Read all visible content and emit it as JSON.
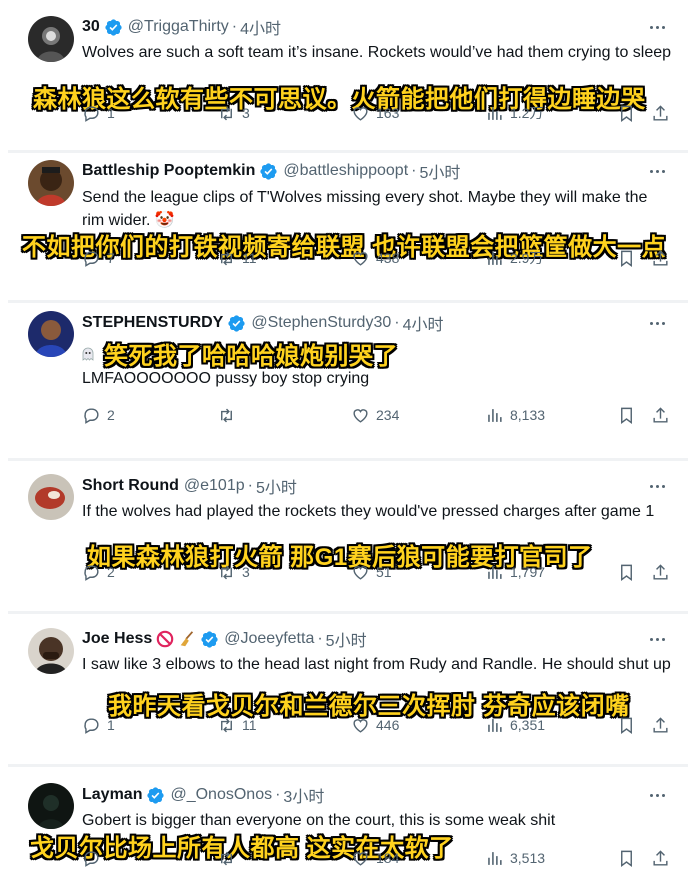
{
  "tweets": [
    {
      "name": "30",
      "handle": "@TriggaThirty",
      "time": "4小时",
      "text": "Wolves are such a soft team it’s insane. Rockets would’ve had them crying to sleep",
      "subtitle": "森林狼这么软有些不可思议。火箭能把他们打得边睡边哭",
      "replies": "1",
      "retweets": "3",
      "likes": "163",
      "views": "1.2万"
    },
    {
      "name": "Battleship Pooptemkin",
      "handle": "@battleshippoopt",
      "time": "5小时",
      "text": "Send the league clips of T'Wolves missing every shot. Maybe they will make the rim wider. 🤡",
      "subtitle": "不如把你们的打铁视频寄给联盟 也许联盟会把篮筐做大一点",
      "replies": "7",
      "retweets": "11",
      "likes": "438",
      "views": "2.9万"
    },
    {
      "name": "STEPHENSTURDY",
      "handle": "@StephenSturdy30",
      "time": "4小时",
      "text": "LMFAOOOOOOO pussy boy stop crying",
      "subtitle": "笑死我了哈哈哈娘炮别哭了",
      "replies": "2",
      "retweets": "",
      "likes": "234",
      "views": "8,133"
    },
    {
      "name": "Short Round",
      "handle": "@e101p",
      "time": "5小时",
      "text": "If the wolves had played the rockets they would've pressed charges after game 1",
      "subtitle": "如果森林狼打火箭 那G1赛后狼可能要打官司了",
      "replies": "2",
      "retweets": "3",
      "likes": "51",
      "views": "1,797"
    },
    {
      "name": "Joe Hess",
      "handle": "@Joeeyfetta",
      "time": "5小时",
      "text": "I saw like 3 elbows to the head last night from Rudy and Randle. He should shut up",
      "subtitle": "我昨天看戈贝尔和兰德尔三次挥肘 芬奇应该闭嘴",
      "replies": "1",
      "retweets": "11",
      "likes": "446",
      "views": "6,351"
    },
    {
      "name": "Layman",
      "handle": "@_OnosOnos",
      "time": "3小时",
      "text": "Gobert is bigger than everyone on the court, this is some weak shit",
      "subtitle": "戈贝尔比场上所有人都高 这实在太软了",
      "replies": "",
      "retweets": "",
      "likes": "184",
      "views": "3,513"
    }
  ],
  "colors": {
    "verified": "#1d9bf0",
    "subtitle": "#ffd21e",
    "muted": "#536471"
  },
  "icons": [
    "reply-icon",
    "retweet-icon",
    "like-icon",
    "views-icon",
    "bookmark-icon",
    "share-icon",
    "verified-icon",
    "more-icon",
    "clown-emoji",
    "prohibited-emoji",
    "broom-emoji",
    "ghost-emoji"
  ]
}
